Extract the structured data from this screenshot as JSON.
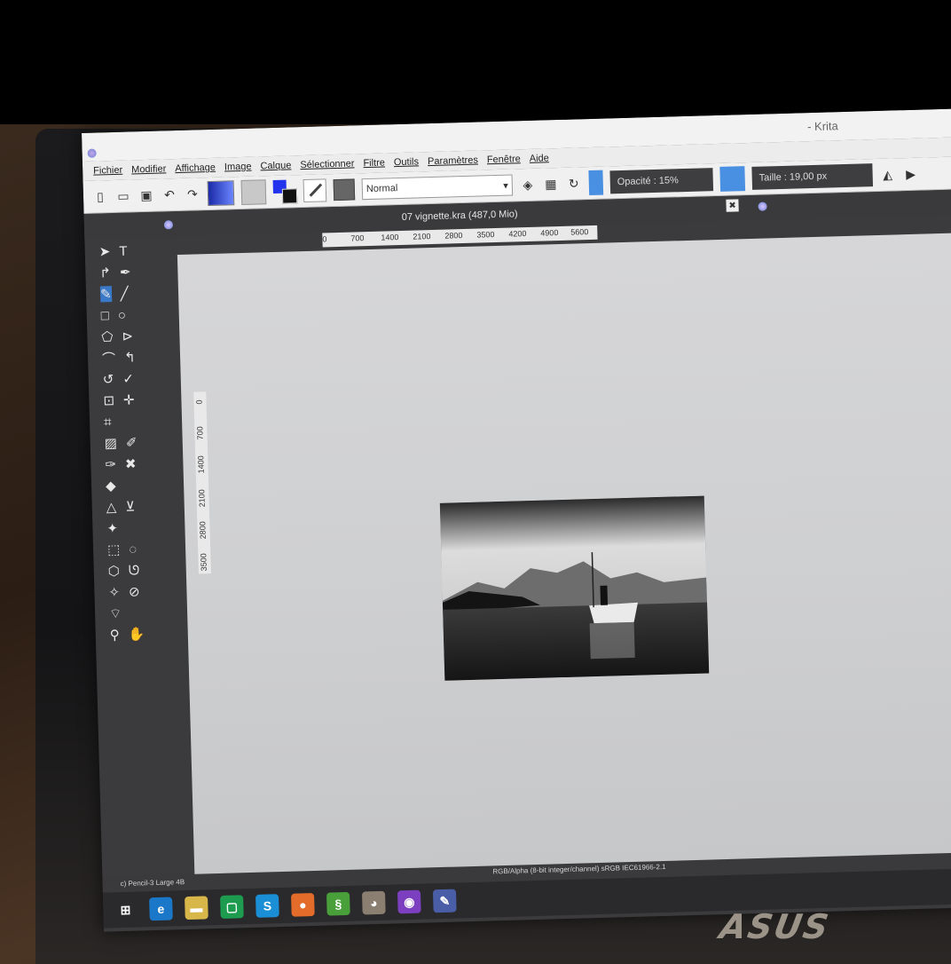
{
  "window": {
    "title": "- Krita"
  },
  "menu": [
    "Fichier",
    "Modifier",
    "Affichage",
    "Image",
    "Calque",
    "Sélectionner",
    "Filtre",
    "Outils",
    "Paramètres",
    "Fenêtre",
    "Aide"
  ],
  "toolbar": {
    "blend_mode": "Normal",
    "opacity_label": "Opacité : 15%",
    "size_label": "Taille : 19,00 px"
  },
  "document": {
    "tab_title": "07 vignette.kra (487,0 Mio)",
    "close_glyph": "✖"
  },
  "ruler": {
    "horizontal": [
      "0",
      "700",
      "1400",
      "2100",
      "2800",
      "3500",
      "4200",
      "4900",
      "5600"
    ],
    "vertical": [
      "0",
      "700",
      "1400",
      "2100",
      "2800",
      "3500"
    ]
  },
  "statusbar": {
    "brush_preset": "c) Pencil-3 Large 4B",
    "color_space": "RGB/Alpha (8-bit integer/channel)  sRGB IEC61966-2.1"
  },
  "taskbar": {
    "apps": [
      {
        "name": "windows-start",
        "glyph": "⊞",
        "color": "#2a2a2c"
      },
      {
        "name": "internet-explorer",
        "glyph": "e",
        "color": "#1b78c8"
      },
      {
        "name": "file-explorer",
        "glyph": "▬",
        "color": "#d7b64a"
      },
      {
        "name": "store",
        "glyph": "▢",
        "color": "#1d9b4f"
      },
      {
        "name": "skype",
        "glyph": "S",
        "color": "#1a8fd6"
      },
      {
        "name": "firefox",
        "glyph": "●",
        "color": "#e36c2a"
      },
      {
        "name": "green-app",
        "glyph": "§",
        "color": "#49a03b"
      },
      {
        "name": "gimp",
        "glyph": "◕",
        "color": "#8a7f70"
      },
      {
        "name": "purple-app",
        "glyph": "◉",
        "color": "#7b3fc0"
      },
      {
        "name": "krita",
        "glyph": "✎",
        "color": "#4a5ea8"
      }
    ]
  },
  "brand": {
    "label": "ASUS"
  }
}
